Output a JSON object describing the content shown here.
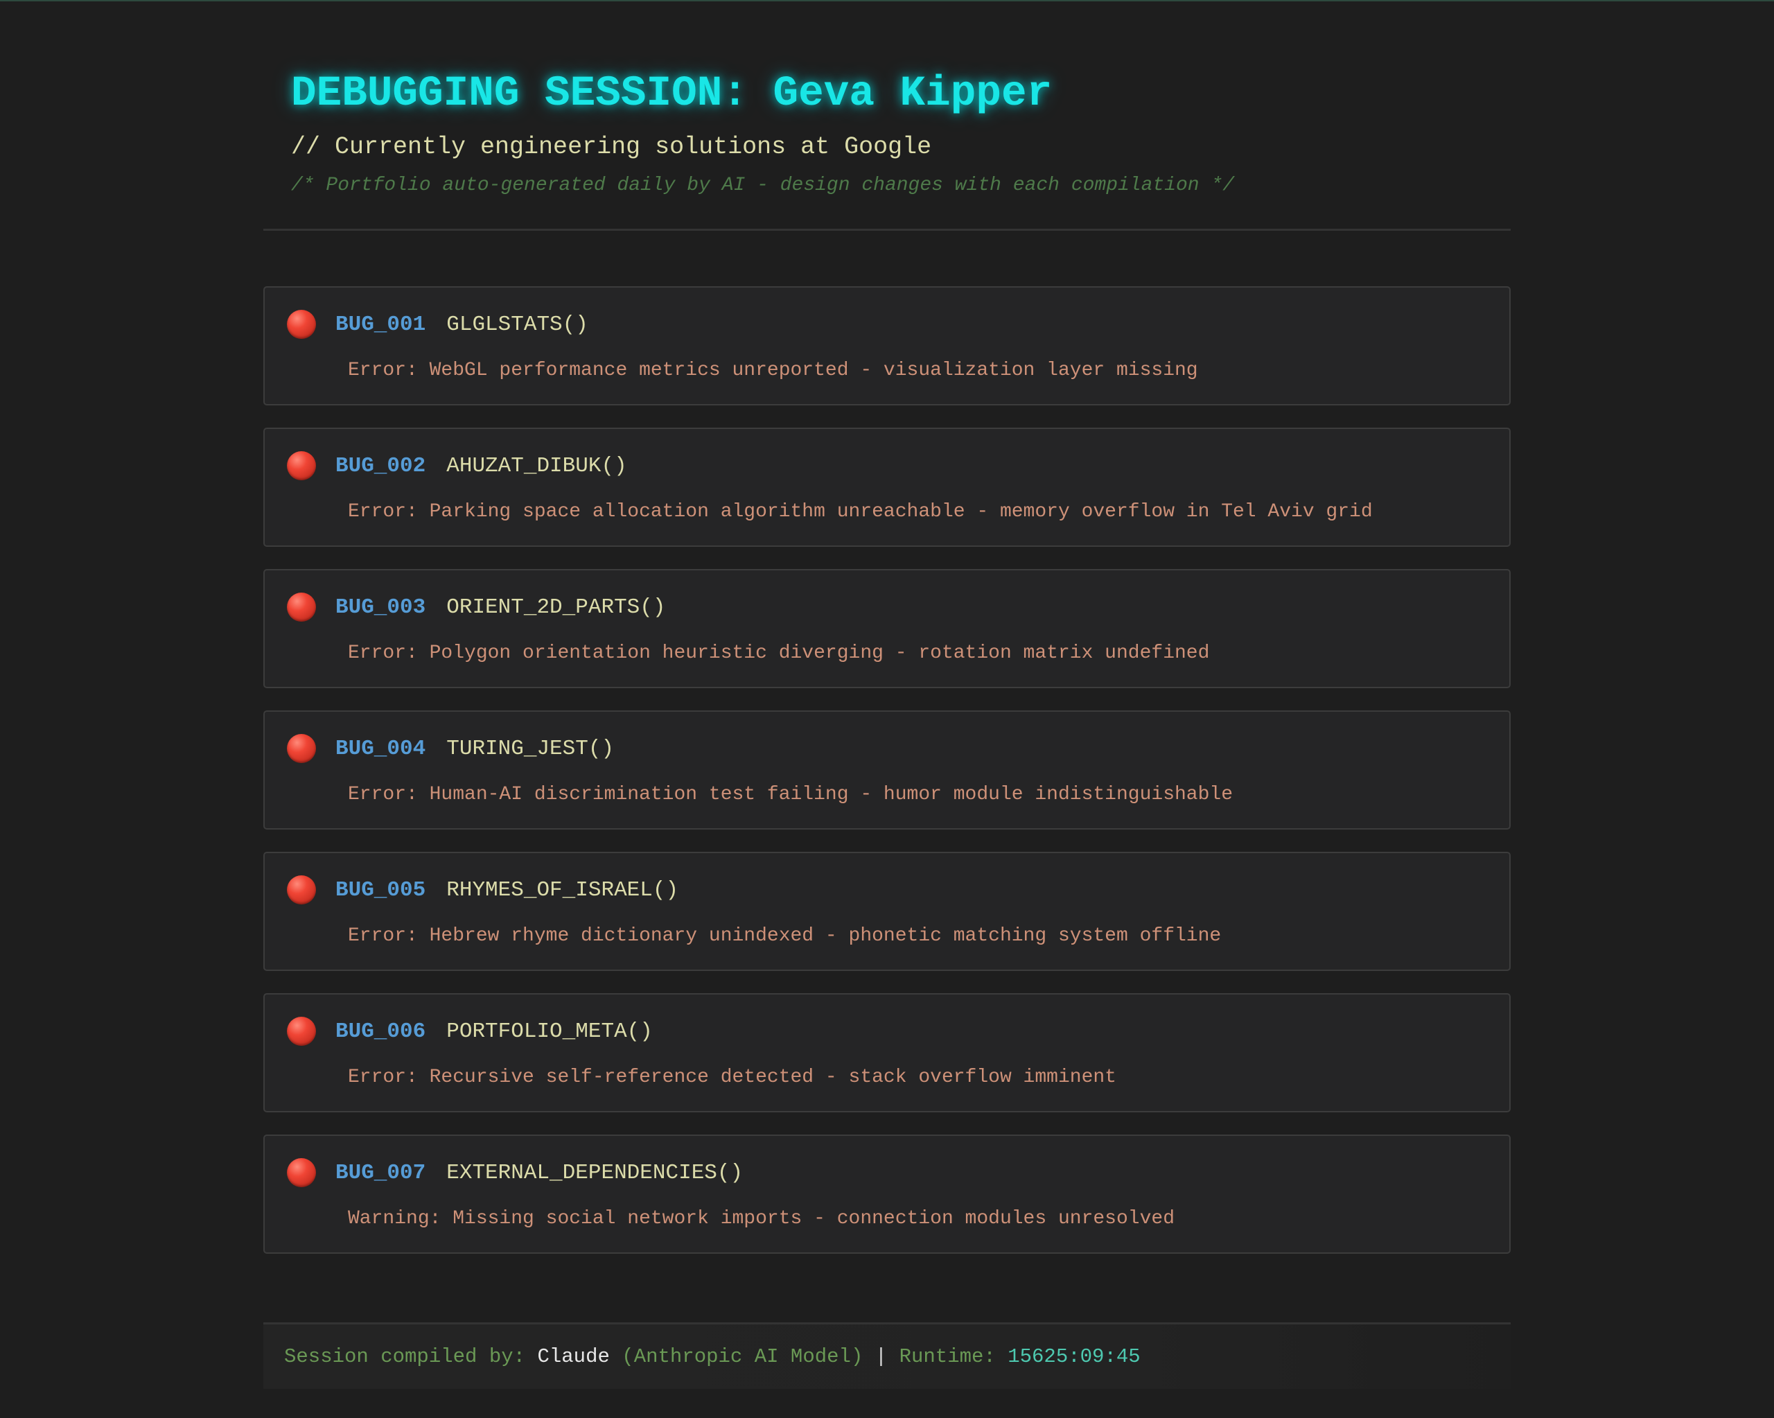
{
  "header": {
    "title": "DEBUGGING SESSION: Geva Kipper",
    "subtitle": "// Currently engineering solutions at Google",
    "note": "/* Portfolio auto-generated daily by AI - design changes with each compilation */"
  },
  "bugs": [
    {
      "id": "BUG_001",
      "function": "GLGLSTATS()",
      "message": "Error: WebGL performance metrics unreported - visualization layer missing",
      "status_icon": "red-circle-icon"
    },
    {
      "id": "BUG_002",
      "function": "AHUZAT_DIBUK()",
      "message": "Error: Parking space allocation algorithm unreachable - memory overflow in Tel Aviv grid",
      "status_icon": "red-circle-icon"
    },
    {
      "id": "BUG_003",
      "function": "ORIENT_2D_PARTS()",
      "message": "Error: Polygon orientation heuristic diverging - rotation matrix undefined",
      "status_icon": "red-circle-icon"
    },
    {
      "id": "BUG_004",
      "function": "TURING_JEST()",
      "message": "Error: Human-AI discrimination test failing - humor module indistinguishable",
      "status_icon": "red-circle-icon"
    },
    {
      "id": "BUG_005",
      "function": "RHYMES_OF_ISRAEL()",
      "message": "Error: Hebrew rhyme dictionary unindexed - phonetic matching system offline",
      "status_icon": "red-circle-icon"
    },
    {
      "id": "BUG_006",
      "function": "PORTFOLIO_META()",
      "message": "Error: Recursive self-reference detected - stack overflow imminent",
      "status_icon": "red-circle-icon"
    },
    {
      "id": "BUG_007",
      "function": "EXTERNAL_DEPENDENCIES()",
      "message": "Warning: Missing social network imports - connection modules unresolved",
      "status_icon": "red-circle-icon"
    }
  ],
  "footer": {
    "compiled_label": "Session compiled by:",
    "compiler_name": "Claude",
    "compiler_detail": "(Anthropic AI Model)",
    "separator": "|",
    "runtime_label": "Runtime:",
    "runtime_value": "15625:09:45"
  },
  "colors": {
    "background": "#1e1e1e",
    "title": "#19e6e6",
    "bug_id": "#569cd6",
    "function": "#dcdcaa",
    "error": "#ce9178",
    "comment": "#6a9955",
    "status_dot": "#f04535"
  }
}
